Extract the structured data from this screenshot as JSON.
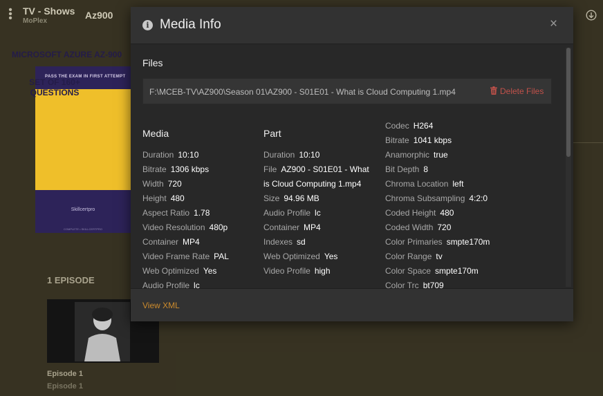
{
  "app": {
    "section": "TV - Shows",
    "server": "MoPlex",
    "show": "Az900"
  },
  "poster": {
    "tagline": "PASS THE EXAM IN FIRST ATTEMPT",
    "title": "MICROSOFT AZURE AZ-900",
    "subtitle": "SET OF 160+ QUESTIONS",
    "brand": "Skillcertpro",
    "footer": "COMPLETE • SKILLCERTPRO"
  },
  "episodes": {
    "heading": "1 EPISODE",
    "items": [
      {
        "title": "Episode 1",
        "subtitle": "Episode 1"
      }
    ]
  },
  "modal": {
    "title": "Media Info",
    "close_glyph": "×",
    "files_heading": "Files",
    "file_path": "F:\\MCEB-TV\\AZ900\\Season 01\\AZ900 - S01E01 - What is Cloud Computing 1.mp4",
    "delete_label": "Delete Files",
    "media_heading": "Media",
    "part_heading": "Part",
    "media": [
      {
        "label": "Duration",
        "value": "10:10"
      },
      {
        "label": "Bitrate",
        "value": "1306 kbps"
      },
      {
        "label": "Width",
        "value": "720"
      },
      {
        "label": "Height",
        "value": "480"
      },
      {
        "label": "Aspect Ratio",
        "value": "1.78"
      },
      {
        "label": "Video Resolution",
        "value": "480p"
      },
      {
        "label": "Container",
        "value": "MP4"
      },
      {
        "label": "Video Frame Rate",
        "value": "PAL"
      },
      {
        "label": "Web Optimized",
        "value": "Yes"
      },
      {
        "label": "Audio Profile",
        "value": "lc"
      }
    ],
    "part": [
      {
        "label": "Duration",
        "value": "10:10"
      },
      {
        "label": "File",
        "value": "AZ900 - S01E01 - What",
        "value2": "is Cloud Computing 1.mp4"
      },
      {
        "label": "Size",
        "value": "94.96 MB"
      },
      {
        "label": "Audio Profile",
        "value": "lc"
      },
      {
        "label": "Container",
        "value": "MP4"
      },
      {
        "label": "Indexes",
        "value": "sd"
      },
      {
        "label": "Web Optimized",
        "value": "Yes"
      },
      {
        "label": "Video Profile",
        "value": "high"
      }
    ],
    "stream": [
      {
        "label": "Codec",
        "value": "H264"
      },
      {
        "label": "Bitrate",
        "value": "1041 kbps"
      },
      {
        "label": "Anamorphic",
        "value": "true"
      },
      {
        "label": "Bit Depth",
        "value": "8"
      },
      {
        "label": "Chroma Location",
        "value": "left"
      },
      {
        "label": "Chroma Subsampling",
        "value": "4:2:0"
      },
      {
        "label": "Coded Height",
        "value": "480"
      },
      {
        "label": "Coded Width",
        "value": "720"
      },
      {
        "label": "Color Primaries",
        "value": "smpte170m"
      },
      {
        "label": "Color Range",
        "value": "tv"
      },
      {
        "label": "Color Space",
        "value": "smpte170m"
      },
      {
        "label": "Color Trc",
        "value": "bt709"
      }
    ],
    "view_xml": "View XML"
  },
  "colors": {
    "accent": "#cc8b2d",
    "danger": "#c0514a",
    "modal_bg": "#282828",
    "page_bg": "#3f3a27"
  }
}
